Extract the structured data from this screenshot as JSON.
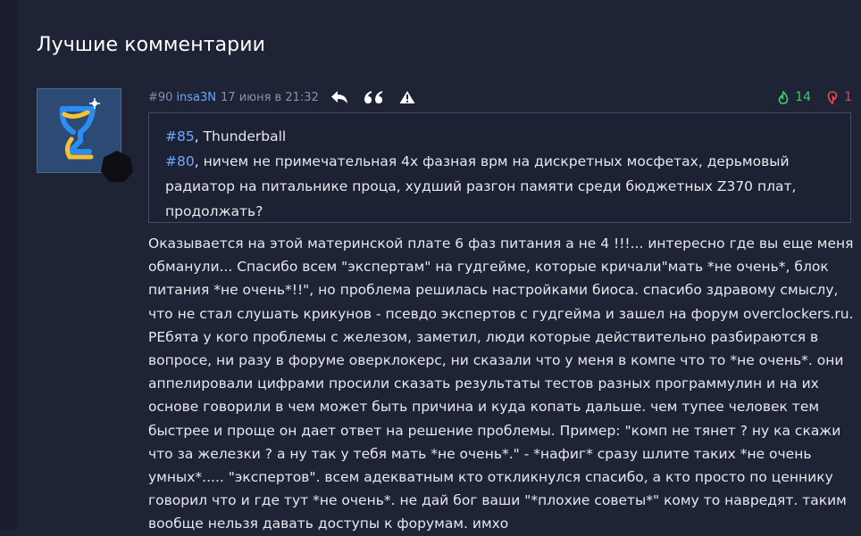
{
  "section": {
    "title": "Лучшие комментарии"
  },
  "comment": {
    "number": "#90",
    "author": "insa3N",
    "date": "17 июня в 21:32",
    "actions": {
      "reply_icon": "reply-icon",
      "quote_icon": "quote-icon",
      "report_icon": "warning-icon"
    },
    "votes": {
      "up": "14",
      "down": "1",
      "up_color": "#46c96a",
      "down_color": "#e8484c"
    },
    "quote": {
      "ref1": "#85",
      "ref1_text": ", Thunderball",
      "ref2": "#80",
      "ref2_text": ", ничем не примечательная 4х фазная врм на дискретных мосфетах, дерьмовый радиатор на питальнике проца, худший разгон памяти среди бюджетных Z370 плат, продолжать?"
    },
    "text": "Оказывается на этой материнской плате 6 фаз питания а не 4 !!!... интересно где вы еще меня обманули... Спасибо всем \"экспертам\" на гудгейме, которые кричали\"мать *не очень*, блок питания *не очень*!!\", но проблема решилась настройками биоса. спасибо здравому смыслу, что не стал слушать крикунов - псевдо экспертов с гудгейма и зашел на форум overclockers.ru. РЕбята у кого проблемы с железом, заметил, люди которые действительно разбираются в вопросе, ни разу в форуме оверклокерс, ни сказали что у меня в компе что то *не очень*. они аппелировали цифрами просили сказать результаты тестов разных программулин и на их основе говорили в чем может быть причина и куда копать дальше. чем тупее человек тем быстрее и проще он дает ответ на решение проблемы. Пример: \"комп не тянет ? ну ка скажи что за железки ? а ну так у тебя мать *не очень*.\" - *нафиг* сразу шлите таких *не очень умных*..... \"экспертов\". всем адекватным кто откликнулся спасибо, а кто просто по ценнику говорил что и где тут *не очень*. не дай бог ваши \"*плохие советы*\" кому то навредят. таким вообще нельзя давать доступы к форумам. имхо"
  }
}
